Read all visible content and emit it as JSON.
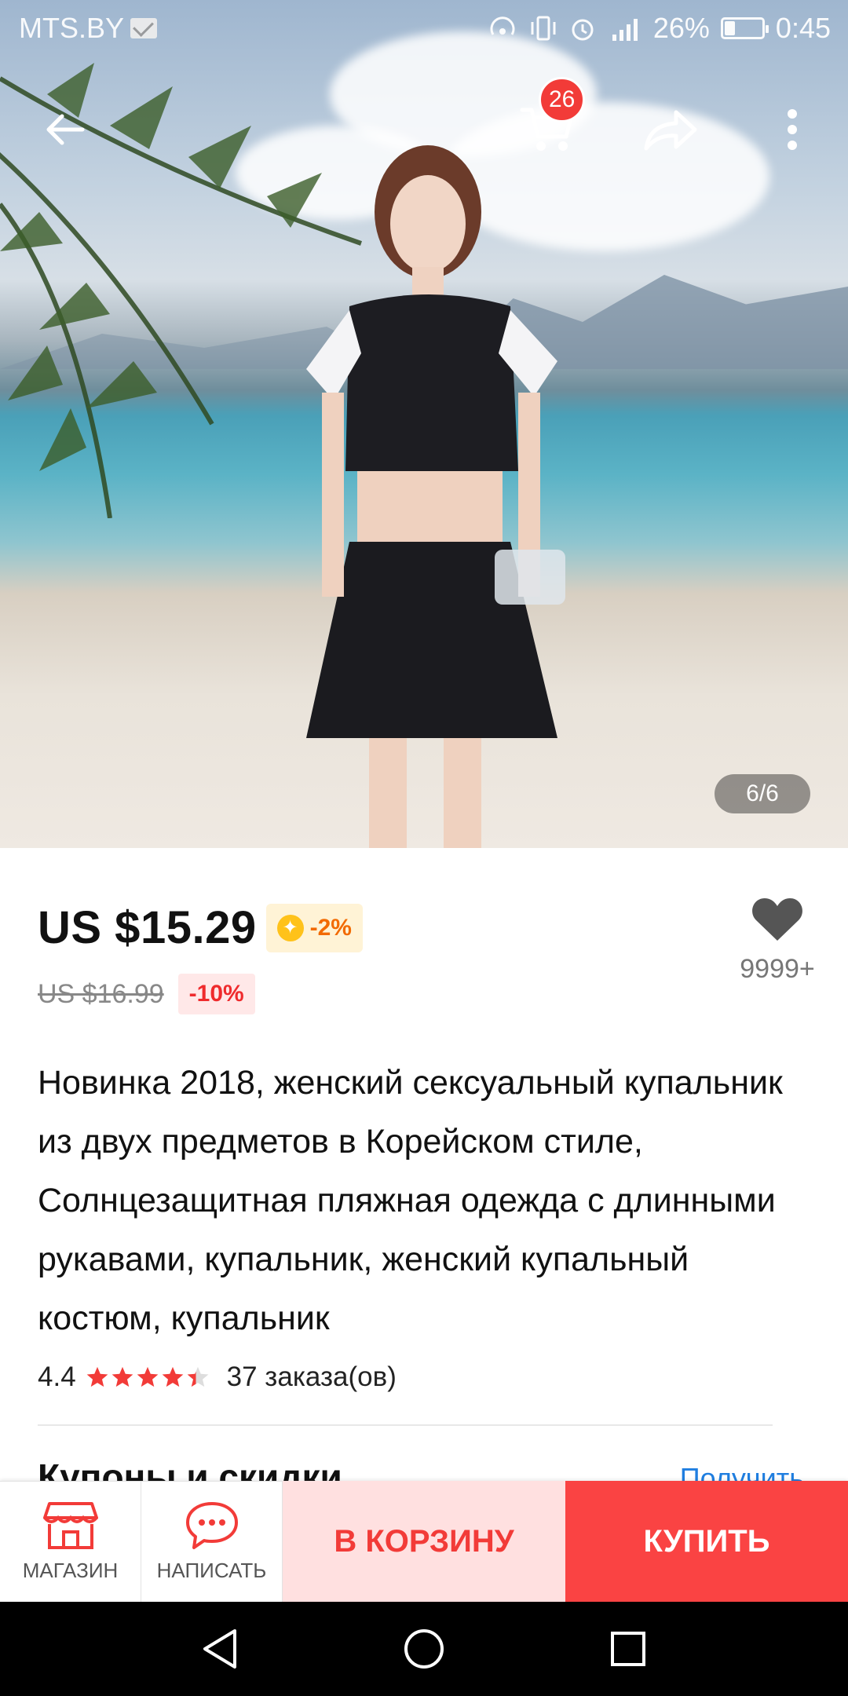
{
  "status_bar": {
    "carrier": "MTS.BY",
    "battery": "26%",
    "battery_level": 0.26,
    "time": "0:45"
  },
  "header": {
    "cart_count": "26"
  },
  "gallery": {
    "counter": "6/6"
  },
  "product": {
    "price": "US $15.29",
    "coin_discount": "-2%",
    "original_price": "US $16.99",
    "discount": "-10%",
    "wishlist_count": "9999+",
    "title": "Новинка 2018, женский сексуальный купальник из двух предметов в Корейском стиле, Солнцезащитная пляжная одежда с длинными рукавами, купальник, женский купальный костюм, купальник",
    "rating": "4.4",
    "rating_value": 4.4,
    "orders": "37 заказа(ов)",
    "coupons_title": "Купоны и скидки",
    "coupons_link": "Получить"
  },
  "actions": {
    "store_label": "МАГАЗИН",
    "message_label": "НАПИСАТЬ",
    "add_to_cart_label": "В КОРЗИНУ",
    "buy_label": "КУПИТЬ"
  },
  "colors": {
    "accent_red": "#fa4343",
    "cart_pink": "#ffe0e0",
    "star": "#f23b38",
    "link_blue": "#1f7ee0"
  }
}
